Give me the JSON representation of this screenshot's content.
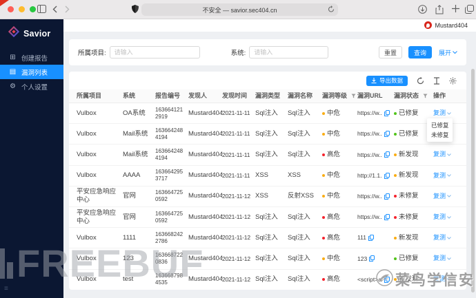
{
  "browser": {
    "url_text": "不安全 — savior.sec404.cn"
  },
  "brand": {
    "name": "Savior"
  },
  "user": {
    "name": "Mustard404"
  },
  "sidebar": {
    "items": [
      {
        "label": "创建报告",
        "icon": "plus-square"
      },
      {
        "label": "漏洞列表",
        "icon": "list",
        "active": true
      },
      {
        "label": "个人设置",
        "icon": "gear"
      }
    ]
  },
  "filters": {
    "project_label": "所属项目:",
    "project_placeholder": "请输入",
    "system_label": "系统:",
    "system_placeholder": "请输入",
    "reset_label": "重置",
    "query_label": "查询",
    "expand_label": "展开"
  },
  "toolbar": {
    "export_label": "导出数据"
  },
  "table": {
    "columns": [
      "所属项目",
      "系统",
      "报告编号",
      "发现人",
      "发现时间",
      "漏洞类型",
      "漏洞名称",
      "漏洞等级",
      "漏洞URL",
      "漏洞状态",
      "操作"
    ],
    "rows": [
      {
        "project": "Vulbox",
        "system": "OA系统",
        "report_no": "1636641212919",
        "finder": "Mustard404",
        "found_at": "2021-11-11",
        "type": "Sql注入",
        "name": "Sql注入",
        "level": {
          "text": "中危",
          "color": "#faad14"
        },
        "url": "https://w...",
        "status": {
          "text": "已修复",
          "color": "#52c41a"
        },
        "action": "复测"
      },
      {
        "project": "Vulbox",
        "system": "Mail系统",
        "report_no": "1636642484194",
        "finder": "Mustard404",
        "found_at": "2021-11-11",
        "type": "Sql注入",
        "name": "Sql注入",
        "level": {
          "text": "中危",
          "color": "#faad14"
        },
        "url": "https://w...",
        "status": {
          "text": "已修复",
          "color": "#52c41a"
        },
        "action": "复测"
      },
      {
        "project": "Vulbox",
        "system": "Mail系统",
        "report_no": "1636642484194",
        "finder": "Mustard404",
        "found_at": "2021-11-11",
        "type": "Sql注入",
        "name": "Sql注入",
        "level": {
          "text": "高危",
          "color": "#f5222d"
        },
        "url": "https://w...",
        "status": {
          "text": "新发现",
          "color": "#faad14"
        },
        "action": "复测"
      },
      {
        "project": "Vulbox",
        "system": "AAAA",
        "report_no": "1636642953717",
        "finder": "Mustard404",
        "found_at": "2021-11-11",
        "type": "XSS",
        "name": "XSS",
        "level": {
          "text": "中危",
          "color": "#faad14"
        },
        "url": "http://1.1...",
        "status": {
          "text": "新发现",
          "color": "#faad14"
        },
        "action": "复测"
      },
      {
        "project": "平安应急响应中心",
        "system": "官网",
        "report_no": "1636647250592",
        "finder": "Mustard404",
        "found_at": "2021-11-12",
        "type": "XSS",
        "name": "反射XSS",
        "level": {
          "text": "中危",
          "color": "#faad14"
        },
        "url": "https://w...",
        "status": {
          "text": "未修复",
          "color": "#f5222d"
        },
        "action": "复测"
      },
      {
        "project": "平安应急响应中心",
        "system": "官网",
        "report_no": "1636647250592",
        "finder": "Mustard404",
        "found_at": "2021-11-12",
        "type": "Sql注入",
        "name": "Sql注入",
        "level": {
          "text": "高危",
          "color": "#f5222d"
        },
        "url": "https://w...",
        "status": {
          "text": "未修复",
          "color": "#f5222d"
        },
        "action": "复测"
      },
      {
        "project": "Vulbox",
        "system": "1111",
        "report_no": "1636682422786",
        "finder": "Mustard404",
        "found_at": "2021-11-12",
        "type": "Sql注入",
        "name": "Sql注入",
        "level": {
          "text": "高危",
          "color": "#f5222d"
        },
        "url": "111",
        "status": {
          "text": "新发现",
          "color": "#faad14"
        },
        "action": "复测"
      },
      {
        "project": "Vulbox",
        "system": "123",
        "report_no": "1636687220836",
        "finder": "Mustard404",
        "found_at": "2021-11-12",
        "type": "Sql注入",
        "name": "Sql注入",
        "level": {
          "text": "中危",
          "color": "#faad14"
        },
        "url": "123",
        "status": {
          "text": "已修复",
          "color": "#52c41a"
        },
        "action": "复测"
      },
      {
        "project": "Vulbox",
        "system": "test",
        "report_no": "1636687984535",
        "finder": "Mustard404",
        "found_at": "2021-11-12",
        "type": "Sql注入",
        "name": "Sql注入",
        "level": {
          "text": "高危",
          "color": "#f5222d"
        },
        "url": "<script>al...",
        "status": {
          "text": "新发现",
          "color": "#faad14"
        },
        "action": "复测"
      }
    ]
  },
  "dropdown": {
    "items": [
      {
        "label": "已修复"
      },
      {
        "label": "未修复"
      }
    ]
  },
  "watermarks": {
    "freebuf": "FREEBUF",
    "site": "菜鸟学信安"
  },
  "colors": {
    "accent": "#1890ff",
    "sidebar_bg": "#0b1732",
    "level_mid": "#faad14",
    "level_high": "#f5222d",
    "status_fixed": "#52c41a",
    "status_new": "#faad14",
    "status_unfixed": "#f5222d"
  }
}
